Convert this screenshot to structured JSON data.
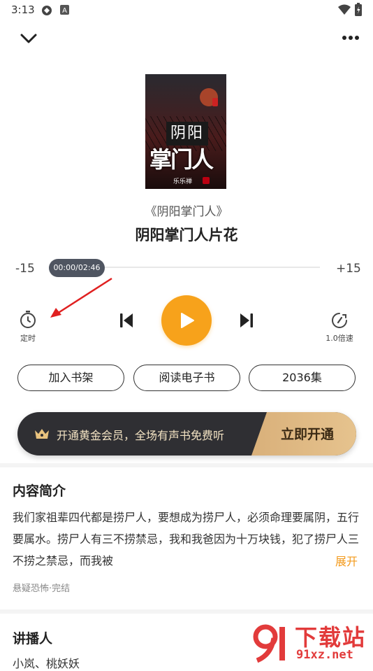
{
  "status_bar": {
    "time": "3:13"
  },
  "book": {
    "name": "《阴阳掌门人》",
    "episode_title": "阴阳掌门人片花",
    "cover": {
      "title_top": "阴阳",
      "title_bottom": "掌门人",
      "author": "乐乐禅"
    }
  },
  "player": {
    "rewind_label": "-15",
    "forward_label": "+15",
    "time_display": "00:00/02:46",
    "progress": 0.0,
    "timer_label": "定时",
    "speed_label": "1.0倍速",
    "accent_color": "#f7a21b"
  },
  "actions": {
    "shelf": "加入书架",
    "ebook": "阅读电子书",
    "episodes": "2036集"
  },
  "vip": {
    "text": "开通黄金会员，全场有声书免费听",
    "cta": "立即开通"
  },
  "intro": {
    "heading": "内容简介",
    "text": "我们家祖辈四代都是捞尸人，要想成为捞尸人，必须命理要属阴，五行要属水。捞尸人有三不捞禁忌，我和我爸因为十万块钱，犯了捞尸人三不捞之禁忌，而我被",
    "expand": "展开",
    "tags": "悬疑恐怖·完结"
  },
  "narrator": {
    "heading": "讲播人",
    "names": "小岚、桃妖妖"
  },
  "watermark": {
    "text": "下载站",
    "url": "91xz.net"
  },
  "icons": {
    "back": "chevron-down-icon",
    "more": "more-dots-icon",
    "timer": "timer-icon",
    "previous": "skip-previous-icon",
    "play": "play-icon",
    "next": "skip-next-icon",
    "speed": "speed-icon",
    "crown": "crown-icon"
  }
}
